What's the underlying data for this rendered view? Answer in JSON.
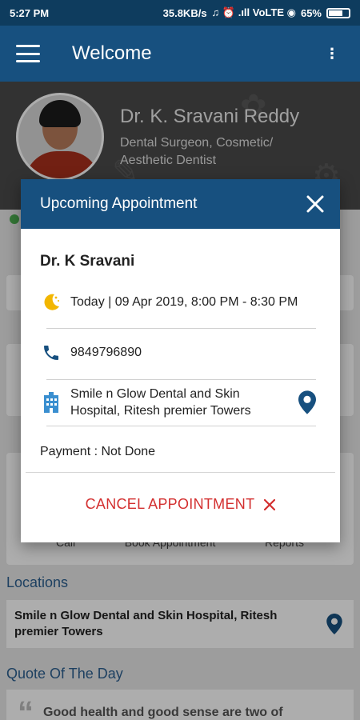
{
  "status_bar": {
    "time": "5:27 PM",
    "network_speed": "35.8KB/s",
    "signal_icons": "♫ ⏰ .ıll VoLTE ◉",
    "battery": "65%"
  },
  "app_bar": {
    "title": "Welcome"
  },
  "doctor": {
    "name": "Dr. K. Sravani Reddy",
    "specialty_line1": "Dental Surgeon, Cosmetic/",
    "specialty_line2": "Aesthetic Dentist"
  },
  "background": {
    "quick_actions": [
      "Call",
      "Book Appointment",
      "Reports"
    ],
    "locations_title": "Locations",
    "location_name": "Smile n Glow Dental and Skin Hospital, Ritesh premier Towers",
    "quote_title": "Quote Of The Day",
    "quote_text": "Good health and good sense are two of"
  },
  "dialog": {
    "title": "Upcoming Appointment",
    "doctor_name": "Dr. K Sravani",
    "datetime": "Today | 09 Apr 2019, 8:00 PM - 8:30 PM",
    "phone": "9849796890",
    "address_line1": "Smile n Glow Dental and Skin",
    "address_line2": "Hospital, Ritesh premier Towers",
    "payment": "Payment : Not Done",
    "cancel_label": "CANCEL APPOINTMENT"
  },
  "colors": {
    "primary": "#17507f",
    "status_bar": "#0e3c5e",
    "accent_cancel": "#d32f2f",
    "moon_icon": "#f2b600"
  },
  "icons": [
    "menu-icon",
    "kebab-icon",
    "close-icon",
    "moon-icon",
    "phone-icon",
    "hospital-icon",
    "location-pin-icon",
    "cancel-x-icon",
    "quote-icon"
  ]
}
